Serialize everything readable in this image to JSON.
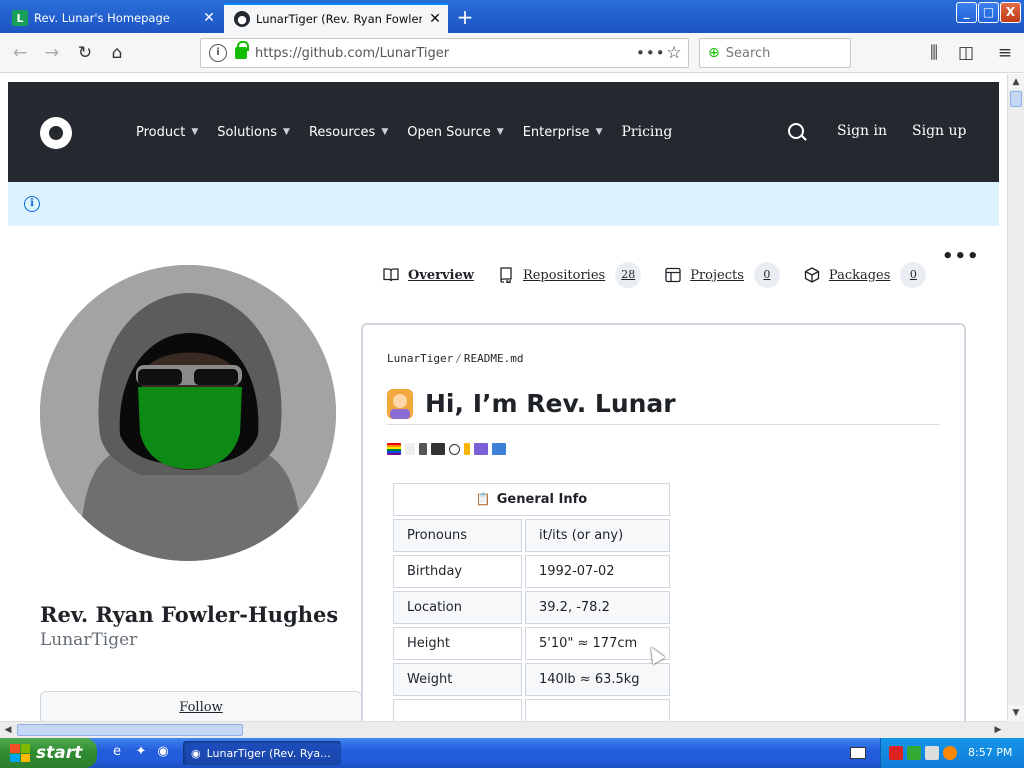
{
  "browser": {
    "tabs": [
      {
        "label": "Rev. Lunar's Homepage",
        "favicon": "L",
        "active": false
      },
      {
        "label": "LunarTiger (Rev. Ryan Fowler-Hu",
        "active": true
      }
    ],
    "url": "https://github.com/LunarTiger",
    "search_placeholder": "Search",
    "window_controls": {
      "minimize": "_",
      "maximize": "□",
      "close": "X"
    },
    "icons": [
      "back-icon",
      "forward-icon",
      "reload-icon",
      "home-icon",
      "info-icon",
      "lock-icon",
      "page-actions-icon",
      "bookmark-star-icon",
      "library-icon",
      "sidebar-icon",
      "menu-icon"
    ]
  },
  "github_header": {
    "menu": [
      {
        "label": "Product",
        "dropdown": true
      },
      {
        "label": "Solutions",
        "dropdown": true
      },
      {
        "label": "Resources",
        "dropdown": true
      },
      {
        "label": "Open Source",
        "dropdown": true
      },
      {
        "label": "Enterprise",
        "dropdown": true
      },
      {
        "label": "Pricing",
        "dropdown": false
      }
    ],
    "sign_in": "Sign in",
    "sign_up": "Sign up"
  },
  "profile": {
    "name": "Rev. Ryan Fowler-Hughes",
    "login": "LunarTiger",
    "follow_label": "Follow"
  },
  "profile_tabs": [
    {
      "label": "Overview",
      "count": null,
      "selected": true,
      "icon": "book-icon"
    },
    {
      "label": "Repositories",
      "count": "28",
      "selected": false,
      "icon": "repo-icon"
    },
    {
      "label": "Projects",
      "count": "0",
      "selected": false,
      "icon": "table-icon"
    },
    {
      "label": "Packages",
      "count": "0",
      "selected": false,
      "icon": "package-icon"
    }
  ],
  "readme": {
    "path_owner": "LunarTiger",
    "path_sep": "/",
    "path_file": "README.md",
    "heading": "Hi, I’m Rev. Lunar",
    "table_title": "General Info",
    "rows": [
      {
        "key": "Pronouns",
        "value": "it/its (or any)"
      },
      {
        "key": "Birthday",
        "value": "1992-07-02"
      },
      {
        "key": "Location",
        "value": "39.2, -78.2"
      },
      {
        "key": "Height",
        "value": "5'10\" ≈ 177cm"
      },
      {
        "key": "Weight",
        "value": "140lb ≈ 63.5kg"
      }
    ]
  },
  "taskbar": {
    "start_label": "start",
    "task_label": "LunarTiger (Rev. Rya...",
    "clock": "8:57 PM"
  },
  "colors": {
    "github_dark": "#24292f",
    "flash_bg": "#ddf4ff",
    "accent": "#0969da",
    "avatar_mask": "#0d8a14"
  }
}
